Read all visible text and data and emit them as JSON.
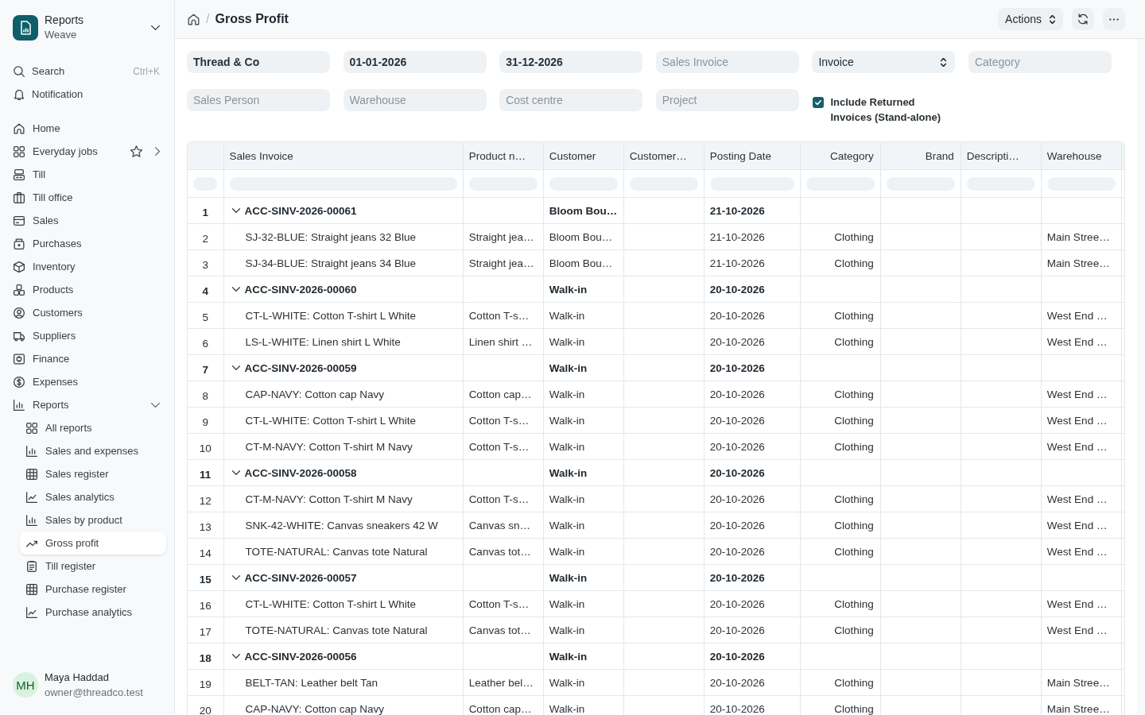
{
  "sidebar": {
    "app": {
      "title": "Reports",
      "subtitle": "Weave"
    },
    "search": {
      "label": "Search",
      "shortcut": "Ctrl+K"
    },
    "notification": {
      "label": "Notification"
    },
    "items": [
      {
        "label": "Home",
        "selected": false
      },
      {
        "label": "Everyday jobs",
        "selected": false,
        "starred": false,
        "expanded": false
      },
      {
        "label": "Till",
        "selected": false
      },
      {
        "label": "Till office",
        "selected": false
      },
      {
        "label": "Sales",
        "selected": false
      },
      {
        "label": "Purchases",
        "selected": false
      },
      {
        "label": "Inventory",
        "selected": false
      },
      {
        "label": "Products",
        "selected": false
      },
      {
        "label": "Customers",
        "selected": false
      },
      {
        "label": "Suppliers",
        "selected": false
      },
      {
        "label": "Finance",
        "selected": false
      },
      {
        "label": "Expenses",
        "selected": false
      },
      {
        "label": "Reports",
        "selected": false,
        "expanded": true,
        "children": [
          {
            "label": "All reports",
            "selected": false
          },
          {
            "label": "Sales and expenses",
            "selected": false
          },
          {
            "label": "Sales register",
            "selected": false
          },
          {
            "label": "Sales analytics",
            "selected": false
          },
          {
            "label": "Sales by product",
            "selected": false
          },
          {
            "label": "Gross profit",
            "selected": true
          },
          {
            "label": "Till register",
            "selected": false
          },
          {
            "label": "Purchase register",
            "selected": false
          },
          {
            "label": "Purchase analytics",
            "selected": false
          }
        ]
      }
    ],
    "user": {
      "initials": "MH",
      "name": "Maya Haddad",
      "email": "owner@threadco.test"
    }
  },
  "header": {
    "breadcrumb_separator": "/",
    "title": "Gross Profit",
    "actions_button": "Actions"
  },
  "filters": [
    {
      "kind": "text",
      "value": "Thread & Co"
    },
    {
      "kind": "date",
      "value": "01-01-2026"
    },
    {
      "kind": "date",
      "value": "31-12-2026"
    },
    {
      "kind": "text",
      "placeholder": "Sales Invoice"
    },
    {
      "kind": "select",
      "value": "Invoice"
    },
    {
      "kind": "text",
      "placeholder": "Category"
    },
    {
      "kind": "text",
      "placeholder": "Sales Person"
    },
    {
      "kind": "text",
      "placeholder": "Warehouse"
    },
    {
      "kind": "text",
      "placeholder": "Cost centre"
    },
    {
      "kind": "text",
      "placeholder": "Project"
    },
    {
      "kind": "checkbox",
      "label": "Include Returned Invoices (Stand-alone)",
      "checked": true
    }
  ],
  "table": {
    "columns": [
      "Sales Invoice",
      "Product n…",
      "Customer",
      "Customer…",
      "Posting Date",
      "Category",
      "Brand",
      "Descripti…",
      "Warehouse"
    ],
    "rows": [
      {
        "number": "1",
        "kind": "group",
        "expanded": true,
        "cells": [
          "ACC-SINV-2026-00061",
          null,
          "Bloom Bou…",
          null,
          "21-10-2026",
          null,
          null,
          null,
          null
        ]
      },
      {
        "number": "2",
        "kind": "item",
        "cells": [
          "SJ-32-BLUE: Straight jeans 32 Blue",
          "Straight jea…",
          "Bloom Bou…",
          null,
          "21-10-2026",
          "Clothing",
          null,
          null,
          "Main Stree…"
        ]
      },
      {
        "number": "3",
        "kind": "item",
        "cells": [
          "SJ-34-BLUE: Straight jeans 34 Blue",
          "Straight jea…",
          "Bloom Bou…",
          null,
          "21-10-2026",
          "Clothing",
          null,
          null,
          "Main Stree…"
        ]
      },
      {
        "number": "4",
        "kind": "group",
        "expanded": true,
        "cells": [
          "ACC-SINV-2026-00060",
          null,
          "Walk-in",
          null,
          "20-10-2026",
          null,
          null,
          null,
          null
        ]
      },
      {
        "number": "5",
        "kind": "item",
        "cells": [
          "CT-L-WHITE: Cotton T-shirt L White",
          "Cotton T-s…",
          "Walk-in",
          null,
          "20-10-2026",
          "Clothing",
          null,
          null,
          "West End …"
        ]
      },
      {
        "number": "6",
        "kind": "item",
        "cells": [
          "LS-L-WHITE: Linen shirt L White",
          "Linen shirt …",
          "Walk-in",
          null,
          "20-10-2026",
          "Clothing",
          null,
          null,
          "West End …"
        ]
      },
      {
        "number": "7",
        "kind": "group",
        "expanded": true,
        "cells": [
          "ACC-SINV-2026-00059",
          null,
          "Walk-in",
          null,
          "20-10-2026",
          null,
          null,
          null,
          null
        ]
      },
      {
        "number": "8",
        "kind": "item",
        "cells": [
          "CAP-NAVY: Cotton cap Navy",
          "Cotton cap…",
          "Walk-in",
          null,
          "20-10-2026",
          "Clothing",
          null,
          null,
          "West End …"
        ]
      },
      {
        "number": "9",
        "kind": "item",
        "cells": [
          "CT-L-WHITE: Cotton T-shirt L White",
          "Cotton T-s…",
          "Walk-in",
          null,
          "20-10-2026",
          "Clothing",
          null,
          null,
          "West End …"
        ]
      },
      {
        "number": "10",
        "kind": "item",
        "cells": [
          "CT-M-NAVY: Cotton T-shirt M Navy",
          "Cotton T-s…",
          "Walk-in",
          null,
          "20-10-2026",
          "Clothing",
          null,
          null,
          "West End …"
        ]
      },
      {
        "number": "11",
        "kind": "group",
        "expanded": true,
        "cells": [
          "ACC-SINV-2026-00058",
          null,
          "Walk-in",
          null,
          "20-10-2026",
          null,
          null,
          null,
          null
        ]
      },
      {
        "number": "12",
        "kind": "item",
        "cells": [
          "CT-M-NAVY: Cotton T-shirt M Navy",
          "Cotton T-s…",
          "Walk-in",
          null,
          "20-10-2026",
          "Clothing",
          null,
          null,
          "West End …"
        ]
      },
      {
        "number": "13",
        "kind": "item",
        "cells": [
          "SNK-42-WHITE: Canvas sneakers 42 W",
          "Canvas sn…",
          "Walk-in",
          null,
          "20-10-2026",
          "Clothing",
          null,
          null,
          "West End …"
        ]
      },
      {
        "number": "14",
        "kind": "item",
        "cells": [
          "TOTE-NATURAL: Canvas tote Natural",
          "Canvas tot…",
          "Walk-in",
          null,
          "20-10-2026",
          "Clothing",
          null,
          null,
          "West End …"
        ]
      },
      {
        "number": "15",
        "kind": "group",
        "expanded": true,
        "cells": [
          "ACC-SINV-2026-00057",
          null,
          "Walk-in",
          null,
          "20-10-2026",
          null,
          null,
          null,
          null
        ]
      },
      {
        "number": "16",
        "kind": "item",
        "cells": [
          "CT-L-WHITE: Cotton T-shirt L White",
          "Cotton T-s…",
          "Walk-in",
          null,
          "20-10-2026",
          "Clothing",
          null,
          null,
          "West End …"
        ]
      },
      {
        "number": "17",
        "kind": "item",
        "cells": [
          "TOTE-NATURAL: Canvas tote Natural",
          "Canvas tot…",
          "Walk-in",
          null,
          "20-10-2026",
          "Clothing",
          null,
          null,
          "West End …"
        ]
      },
      {
        "number": "18",
        "kind": "group",
        "expanded": true,
        "cells": [
          "ACC-SINV-2026-00056",
          null,
          "Walk-in",
          null,
          "20-10-2026",
          null,
          null,
          null,
          null
        ]
      },
      {
        "number": "19",
        "kind": "item",
        "cells": [
          "BELT-TAN: Leather belt Tan",
          "Leather bel…",
          "Walk-in",
          null,
          "20-10-2026",
          "Clothing",
          null,
          null,
          "Main Stree…"
        ]
      },
      {
        "number": "20",
        "kind": "item",
        "cells": [
          "CAP-NAVY: Cotton cap Navy",
          "Cotton cap…",
          "Walk-in",
          null,
          "20-10-2026",
          "Clothing",
          null,
          null,
          "Main Stree…"
        ]
      }
    ]
  }
}
